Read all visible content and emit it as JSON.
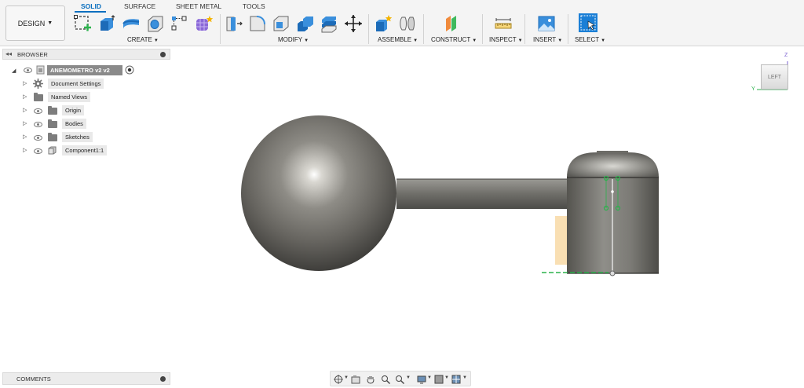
{
  "workspace_button": {
    "label": "DESIGN"
  },
  "tabs": [
    {
      "label": "SOLID",
      "active": true
    },
    {
      "label": "SURFACE",
      "active": false
    },
    {
      "label": "SHEET METAL",
      "active": false
    },
    {
      "label": "TOOLS",
      "active": false
    }
  ],
  "toolbar_groups": {
    "create": "CREATE",
    "modify": "MODIFY",
    "assemble": "ASSEMBLE",
    "construct": "CONSTRUCT",
    "inspect": "INSPECT",
    "insert": "INSERT",
    "select": "SELECT"
  },
  "browser": {
    "title": "BROWSER",
    "root": {
      "label": "ANEMOMETRO v2 v2"
    },
    "items": [
      {
        "label": "Document Settings",
        "icon": "gear-icon",
        "eye": false
      },
      {
        "label": "Named Views",
        "icon": "folder-icon",
        "eye": false
      },
      {
        "label": "Origin",
        "icon": "folder-icon",
        "eye": true
      },
      {
        "label": "Bodies",
        "icon": "folder-icon",
        "eye": true
      },
      {
        "label": "Sketches",
        "icon": "folder-icon",
        "eye": true
      },
      {
        "label": "Component1:1",
        "icon": "component-icon",
        "eye": true
      }
    ]
  },
  "comments": {
    "title": "COMMENTS"
  },
  "viewcube": {
    "face": "LEFT",
    "axis_z": "Z",
    "axis_y": "Y"
  },
  "colors": {
    "accent": "#0a6fbf",
    "sketch_green": "#2bb24c",
    "sketch_plane": "#f7d7a0",
    "model_gray": "#6e6c66"
  }
}
